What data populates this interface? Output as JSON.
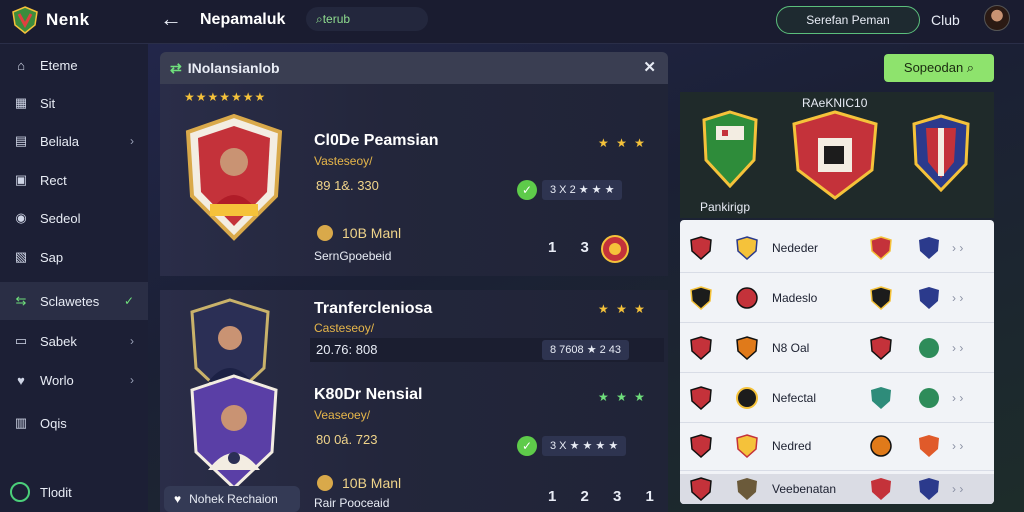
{
  "header": {
    "brand": "Nenk",
    "page_title": "Nepamaluk",
    "search_text": "⌕terub",
    "primary_button": "Serefan Peman",
    "club_link": "Club"
  },
  "sidebar": {
    "items": [
      {
        "label": "Eteme",
        "icon": "home-icon",
        "chevron": ""
      },
      {
        "label": "Sit",
        "icon": "grid-icon",
        "chevron": ""
      },
      {
        "label": "Beliala",
        "icon": "building-icon",
        "chevron": "›"
      },
      {
        "label": "Rect",
        "icon": "calendar-icon",
        "chevron": ""
      },
      {
        "label": "Sedeol",
        "icon": "ball-icon",
        "chevron": ""
      },
      {
        "label": "Sap",
        "icon": "clipboard-icon",
        "chevron": ""
      },
      {
        "label": "Sclawetes",
        "icon": "transfer-icon",
        "chevron": "✓"
      },
      {
        "label": "Sabek",
        "icon": "folder-icon",
        "chevron": "›"
      },
      {
        "label": "Worlo",
        "icon": "heart-icon",
        "chevron": "›"
      },
      {
        "label": "Oqis",
        "icon": "book-icon",
        "chevron": ""
      }
    ],
    "footer_label": "Tlodit",
    "active_index": 6
  },
  "panel": {
    "title": "INolansianlob",
    "close": "✕",
    "stars": "★★★★★★★",
    "cards": [
      {
        "name": "Cl0De Peamsian",
        "subtitle": "Vasteseoy/",
        "stats": "89 1&. 330",
        "club": "10B Manl",
        "meta": "SernGpoebeid",
        "mini_stars": "★ ★ ★",
        "rating": "3 X 2 ★ ★ ★",
        "nums": "1 3 3"
      },
      {
        "name": "Tranfercleniosa",
        "subtitle": "Casteseoy/",
        "stats": "20.76: 808",
        "club": "",
        "meta": "",
        "mini_stars": "★ ★ ★",
        "rating": "8 7608 ★ 2 43",
        "nums": ""
      },
      {
        "name": "K80Dr Nensial",
        "subtitle": "Veaseoey/",
        "stats": "80 0á. 723",
        "club": "10B Manl",
        "meta": "Rair Pooceaid",
        "mini_stars": "★ ★ ★",
        "rating": "3 X ★ ★ ★ ★",
        "nums": "1 2 3 1"
      }
    ],
    "favorite_button": "Nohek Rechaion"
  },
  "right": {
    "action_button": "Sopeodan ⌕",
    "rank_title": "RAeKNIC10",
    "rank_label": "Pankirigp",
    "rows": [
      {
        "name": "Nededer"
      },
      {
        "name": "Madeslo"
      },
      {
        "name": "N8 Oal"
      },
      {
        "name": "Nefectal"
      },
      {
        "name": "Nedred"
      },
      {
        "name": "Veebenatan"
      }
    ]
  },
  "colors": {
    "accent_green": "#6fe07c",
    "button_green": "#8ee36d",
    "star_gold": "#f5c23a",
    "panel_dark": "#23273c"
  }
}
